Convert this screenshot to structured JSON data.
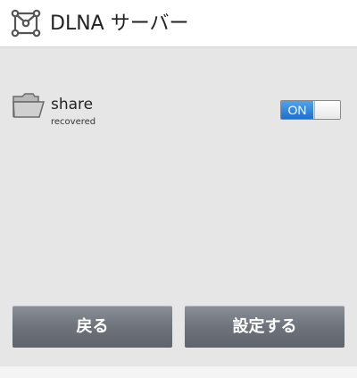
{
  "header": {
    "title": "DLNA サーバー",
    "icon": "network-nodes-icon"
  },
  "share": {
    "name": "share",
    "status": "recovered",
    "icon": "folder-icon",
    "toggle": {
      "state": "ON",
      "on_color": "#2f85e0"
    }
  },
  "buttons": {
    "back_label": "戻る",
    "set_label": "設定する"
  }
}
